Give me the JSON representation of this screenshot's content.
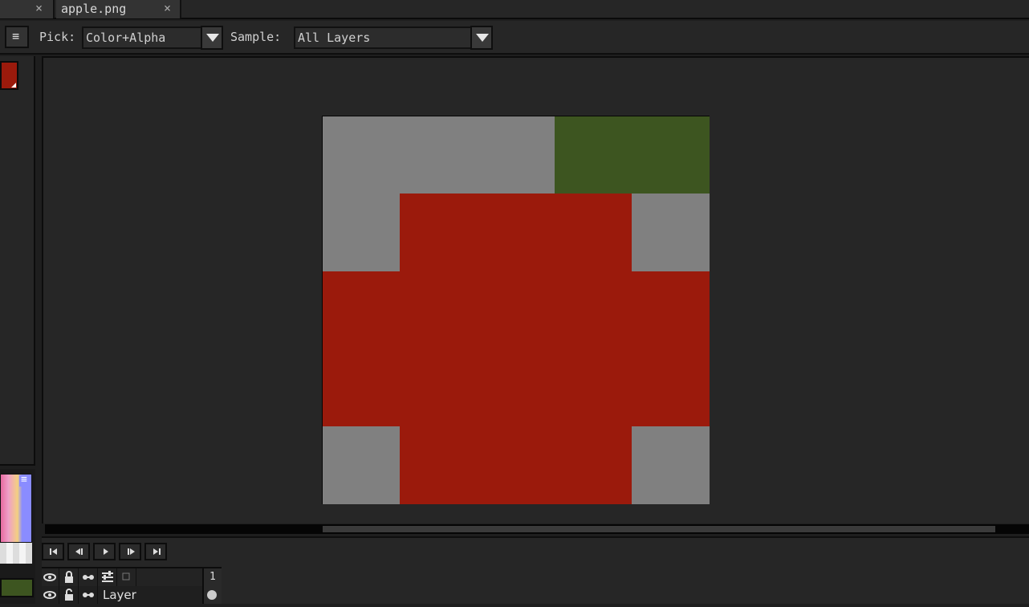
{
  "tabs": [
    {
      "label": "",
      "close": "×"
    },
    {
      "label": "apple.png",
      "close": "×"
    }
  ],
  "toolbar": {
    "menu_icon": "≡",
    "pick_label": "Pick:",
    "pick_value": "Color+Alpha",
    "sample_label": "Sample:",
    "sample_value": "All Layers"
  },
  "colors": {
    "primary": "#9b1a0c",
    "secondary": "#3d5520",
    "sprite_bg": "#808080",
    "leaf": "#3d5520",
    "apple": "#9b1a0c"
  },
  "sprite_grid": [
    [
      0,
      0,
      0,
      2,
      2
    ],
    [
      0,
      1,
      1,
      1,
      0
    ],
    [
      1,
      1,
      1,
      1,
      1
    ],
    [
      1,
      1,
      1,
      1,
      1
    ],
    [
      0,
      1,
      1,
      1,
      0
    ]
  ],
  "timeline": {
    "buttons": [
      "first-frame-icon",
      "prev-frame-icon",
      "play-icon",
      "next-frame-icon",
      "last-frame-icon"
    ],
    "frame_number": "1",
    "layer_name": "Layer"
  }
}
